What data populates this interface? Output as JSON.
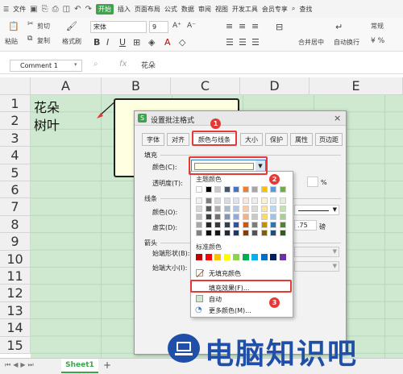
{
  "menubar": {
    "file": "文件",
    "tabs": [
      "开始",
      "插入",
      "页面布局",
      "公式",
      "数据",
      "审阅",
      "视图",
      "开发工具",
      "会员专享"
    ],
    "search": "查找"
  },
  "ribbon": {
    "paste": "粘贴",
    "cut": "剪切",
    "copy": "复制",
    "format_painter": "格式刷",
    "font_name": "宋体",
    "font_size": "9",
    "merge": "合并居中",
    "wrap": "自动换行",
    "number_format": "常规"
  },
  "formula_bar": {
    "name_box": "Comment 1",
    "fx": "fx",
    "value": "花朵"
  },
  "columns": [
    "A",
    "B",
    "C",
    "D",
    "E"
  ],
  "rows": [
    "1",
    "2",
    "3",
    "4",
    "5",
    "6",
    "7",
    "8",
    "9",
    "10",
    "11",
    "12",
    "13",
    "14",
    "15"
  ],
  "cells": {
    "A1": "花朵",
    "A2": "树叶"
  },
  "dialog": {
    "title": "设置批注格式",
    "tabs": [
      "字体",
      "对齐",
      "颜色与线条",
      "大小",
      "保护",
      "属性",
      "页边距"
    ],
    "fill_section": "填充",
    "color_label": "颜色(C):",
    "transparency_label": "透明度(T):",
    "percent": "%",
    "line_section": "线条",
    "line_color_label": "颜色(O):",
    "dash_label": "虚实(D):",
    "weight_value": ".75",
    "weight_unit": "磅",
    "arrow_section": "箭头",
    "begin_style_label": "始端形状(B):",
    "begin_size_label": "始端大小(I):"
  },
  "color_dropdown": {
    "theme_colors": "主题颜色",
    "standard_colors": "标准颜色",
    "no_fill": "无填充颜色",
    "fill_effects": "填充效果(F)...",
    "automatic": "自动",
    "more_colors": "更多颜色(M)..."
  },
  "badges": [
    "1",
    "2",
    "3"
  ],
  "sheet_tab": "Sheet1",
  "add_sheet": "+",
  "watermark": "电脑知识吧",
  "colors": {
    "accent_green": "#3fa34d",
    "grid_green": "#cfe8d0",
    "highlight_red": "#e53935",
    "comment_yellow": "#ffffe1",
    "watermark_blue": "#1f4fa8"
  }
}
